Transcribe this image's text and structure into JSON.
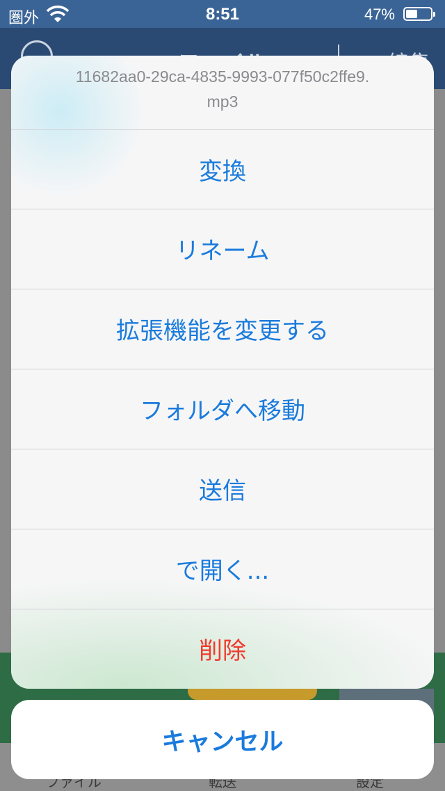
{
  "status_bar": {
    "carrier": "圏外",
    "time": "8:51",
    "battery_percent": "47%",
    "battery_level": 0.47
  },
  "nav_bar": {
    "title": "ファイル",
    "edit_label": "編集"
  },
  "tab_bar": {
    "items": [
      "ファイル",
      "転送",
      "設定"
    ]
  },
  "action_sheet": {
    "title_line1": "11682aa0-29ca-4835-9993-077f50c2ffe9.",
    "title_line2": "mp3",
    "items": [
      {
        "label": "変換"
      },
      {
        "label": "リネーム"
      },
      {
        "label": "拡張機能を変更する"
      },
      {
        "label": "フォルダへ移動"
      },
      {
        "label": "送信"
      },
      {
        "label": "で開く..."
      },
      {
        "label": "削除",
        "destructive": true
      }
    ],
    "cancel_label": "キャンセル"
  },
  "colors": {
    "accent": "#1a7bdc",
    "destructive": "#f03a2c",
    "nav_background": "#3b6496"
  }
}
